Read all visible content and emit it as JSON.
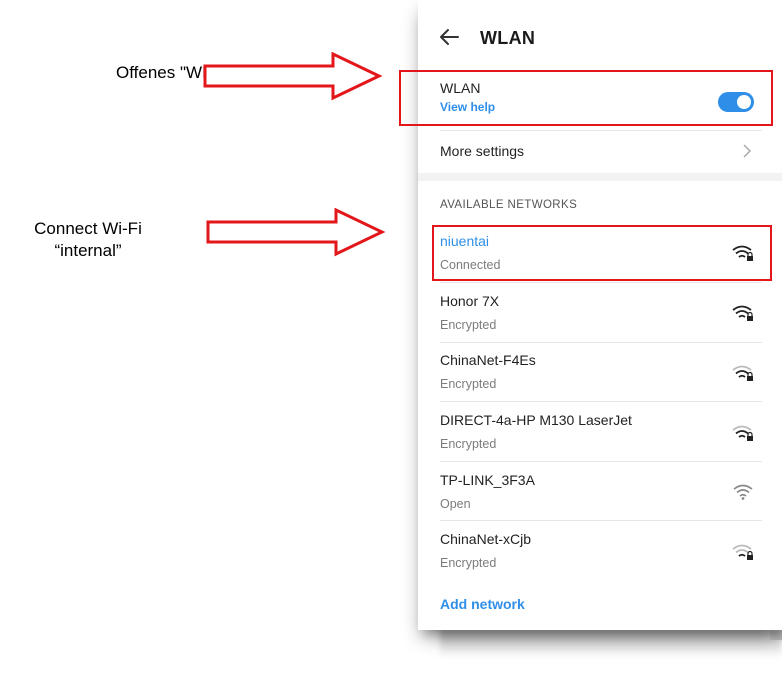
{
  "annotations": {
    "step1": "Offenes \"WLAN\"",
    "step2_line1": "Connect Wi-Fi",
    "step2_line2": "“internal”"
  },
  "colors": {
    "accent": "#2f8fe8",
    "highlight": "#e3161a"
  },
  "header": {
    "title": "WLAN",
    "back_icon": "arrow-left-icon"
  },
  "wlan_row": {
    "label": "WLAN",
    "help_link": "View help",
    "toggle_state": "on"
  },
  "more_settings": {
    "label": "More settings"
  },
  "networks": {
    "section_label": "AVAILABLE NETWORKS",
    "items": [
      {
        "name": "niuentai",
        "status": "Connected",
        "locked": true
      },
      {
        "name": "Honor 7X",
        "status": "Encrypted",
        "locked": true
      },
      {
        "name": "ChinaNet-F4Es",
        "status": "Encrypted",
        "locked": true
      },
      {
        "name": "DIRECT-4a-HP M130 LaserJet",
        "status": "Encrypted",
        "locked": true
      },
      {
        "name": "TP-LINK_3F3A",
        "status": "Open",
        "locked": false
      },
      {
        "name": "ChinaNet-xCjb",
        "status": "Encrypted",
        "locked": true
      }
    ],
    "add_label": "Add network"
  }
}
